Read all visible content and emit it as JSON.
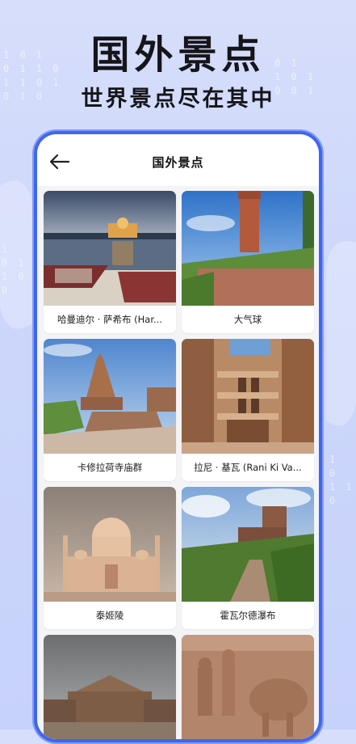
{
  "hero": {
    "title": "国外景点",
    "subtitle": "世界景点尽在其中"
  },
  "appbar": {
    "back_icon": "arrow-left-icon",
    "title": "国外景点"
  },
  "attractions": [
    {
      "name": "哈曼迪尔 · 萨希布 (Har..."
    },
    {
      "name": "大气球"
    },
    {
      "name": "卡修拉荷寺庙群"
    },
    {
      "name": "拉尼 · 基瓦 (Rani Ki Va..."
    },
    {
      "name": "泰姬陵"
    },
    {
      "name": "霍瓦尔德瀑布"
    },
    {
      "name": ""
    },
    {
      "name": ""
    }
  ],
  "colors": {
    "accent": "#3f66f2",
    "background": "#cdd7fb"
  }
}
